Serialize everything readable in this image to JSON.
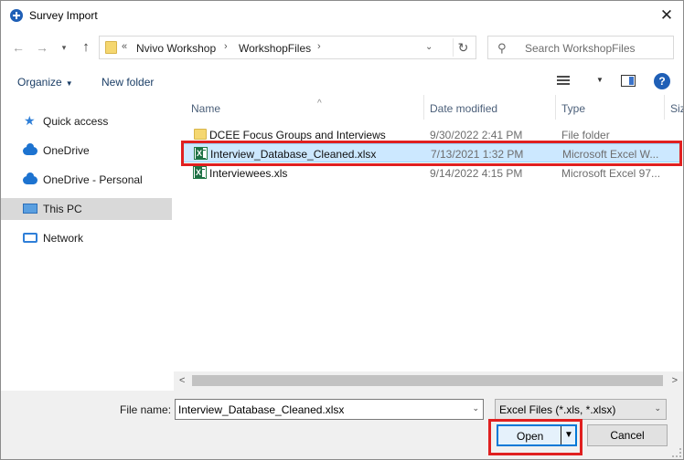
{
  "window": {
    "title": "Survey Import",
    "close_glyph": "✕"
  },
  "nav_buttons": {
    "back": "←",
    "forward": "→",
    "recent": "▾",
    "up": "↑"
  },
  "address": {
    "overflow": "«",
    "segments": [
      "Nvivo Workshop",
      "WorkshopFiles"
    ],
    "separator": "›",
    "dropdown": "⌄",
    "refresh": "↻"
  },
  "search": {
    "placeholder": "Search WorkshopFiles",
    "icon": "search-icon"
  },
  "toolbar": {
    "organize": "Organize",
    "organize_caret": "▼",
    "new_folder": "New folder",
    "view_caret": "▼",
    "help": "?"
  },
  "sidebar": {
    "items": [
      {
        "label": "Quick access",
        "icon": "star-icon"
      },
      {
        "label": "OneDrive",
        "icon": "cloud-icon"
      },
      {
        "label": "OneDrive - Personal",
        "icon": "cloud-icon"
      },
      {
        "label": "This PC",
        "icon": "computer-icon",
        "selected": true
      },
      {
        "label": "Network",
        "icon": "network-icon"
      }
    ]
  },
  "columns": {
    "name": "Name",
    "date": "Date modified",
    "type": "Type",
    "size": "Size",
    "sort_indicator": "^"
  },
  "files": [
    {
      "name": "DCEE Focus Groups and Interviews",
      "date": "9/30/2022 2:41 PM",
      "type": "File folder",
      "kind": "folder"
    },
    {
      "name": "Interview_Database_Cleaned.xlsx",
      "date": "7/13/2021 1:32 PM",
      "type": "Microsoft Excel W...",
      "kind": "excel",
      "selected": true
    },
    {
      "name": "Interviewees.xls",
      "date": "9/14/2022 4:15 PM",
      "type": "Microsoft Excel 97...",
      "kind": "excel"
    }
  ],
  "scrollbar": {
    "left": "<",
    "right": ">"
  },
  "bottom": {
    "file_name_label": "File name:",
    "file_name_value": "Interview_Database_Cleaned.xlsx",
    "file_name_dropdown": "⌄",
    "filter_value": "Excel Files (*.xls, *.xlsx)",
    "filter_dropdown": "⌄",
    "open_label": "Open",
    "open_arrow": "▼",
    "cancel_label": "Cancel"
  },
  "colors": {
    "accent": "#0078d7",
    "selection": "#cce8ff",
    "highlight": "#e02020",
    "header_text": "#4c607a"
  }
}
